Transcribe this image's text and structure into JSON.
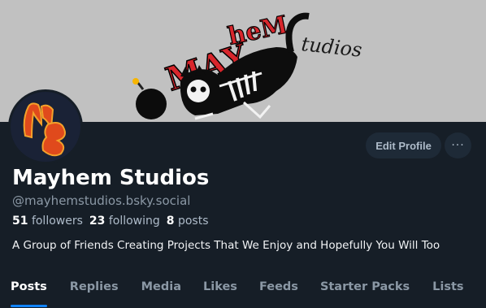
{
  "profile": {
    "display_name": "Mayhem Studios",
    "handle": "@mayhemstudios.bsky.social",
    "bio": "A Group of Friends Creating Projects That We Enjoy and Hopefully You Will Too"
  },
  "stats": {
    "followers_count": "51",
    "followers_label": "followers",
    "following_count": "23",
    "following_label": "following",
    "posts_count": "8",
    "posts_label": "posts"
  },
  "actions": {
    "edit_profile_label": "Edit Profile",
    "more_label": "···"
  },
  "tabs": [
    {
      "label": "Posts",
      "active": true
    },
    {
      "label": "Replies",
      "active": false
    },
    {
      "label": "Media",
      "active": false
    },
    {
      "label": "Likes",
      "active": false
    },
    {
      "label": "Feeds",
      "active": false
    },
    {
      "label": "Starter Packs",
      "active": false
    },
    {
      "label": "Lists",
      "active": false
    }
  ],
  "colors": {
    "background": "#161e27",
    "banner": "#c1c1c1",
    "accent": "#1083fe",
    "logo_red": "#d8262c"
  },
  "banner": {
    "logo_text": "Mayhem Studios"
  }
}
